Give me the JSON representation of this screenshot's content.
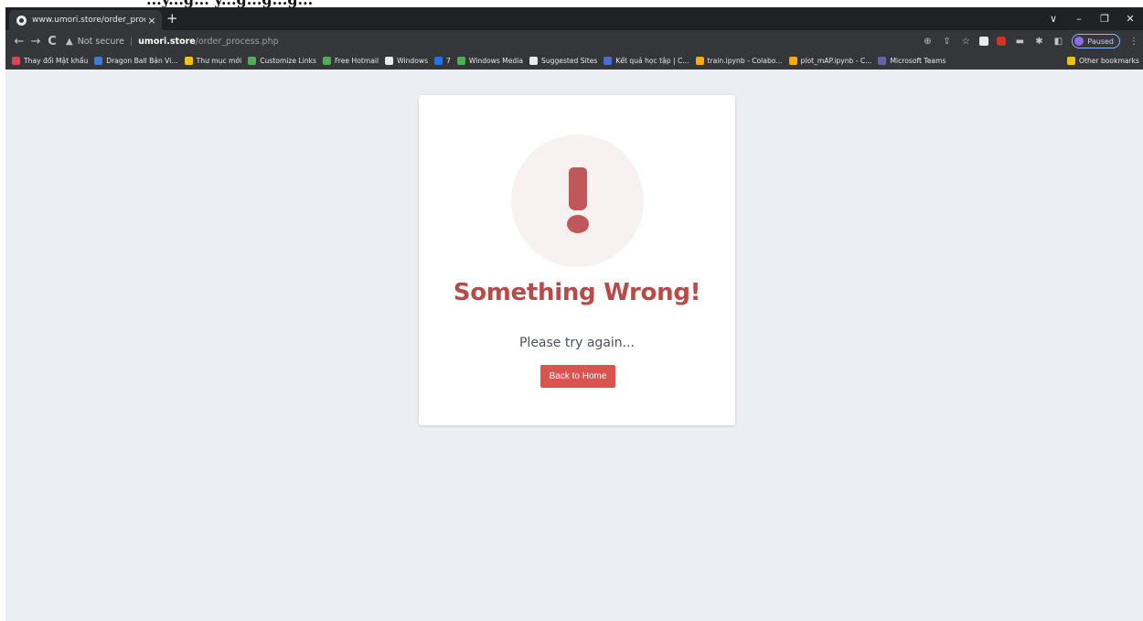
{
  "top_fragment": "...y...g... y...g...g...g...",
  "tab": {
    "title": "www.umori.store/order_process.php",
    "close": "×"
  },
  "new_tab": "+",
  "window_controls": {
    "collapse": "∨",
    "minimize": "–",
    "restore": "❐",
    "close": "✕"
  },
  "nav": {
    "back": "←",
    "forward": "→",
    "reload": "C"
  },
  "address": {
    "security": "Not secure",
    "host": "umori.store",
    "path": "/order_process.php"
  },
  "profile": {
    "label": "Paused"
  },
  "bookmarks": [
    {
      "label": "Thay đổi Mật khẩu",
      "icon": "#e0434d"
    },
    {
      "label": "Dragon Ball Bản Vi...",
      "icon": "#3a7bd5"
    },
    {
      "label": "Thư mục mới",
      "icon": "#f4c20d"
    },
    {
      "label": "Customize Links",
      "icon": "#4caf50"
    },
    {
      "label": "Free Hotmail",
      "icon": "#4caf50"
    },
    {
      "label": "Windows",
      "icon": "#e8eaed"
    },
    {
      "label": "7",
      "icon": "#1877f2"
    },
    {
      "label": "Windows Media",
      "icon": "#4caf50"
    },
    {
      "label": "Suggested Sites",
      "icon": "#e8eaed"
    },
    {
      "label": "Kết quả học tập | C...",
      "icon": "#4a6fd1"
    },
    {
      "label": "train.ipynb - Colabo...",
      "icon": "#f9ab00"
    },
    {
      "label": "plot_mAP.ipynb - C...",
      "icon": "#f9ab00"
    },
    {
      "label": "Microsoft Teams",
      "icon": "#6264a7"
    }
  ],
  "other_bookmarks": "Other bookmarks",
  "card": {
    "headline": "Something Wrong!",
    "message": "Please try again...",
    "button": "Back to Home"
  }
}
